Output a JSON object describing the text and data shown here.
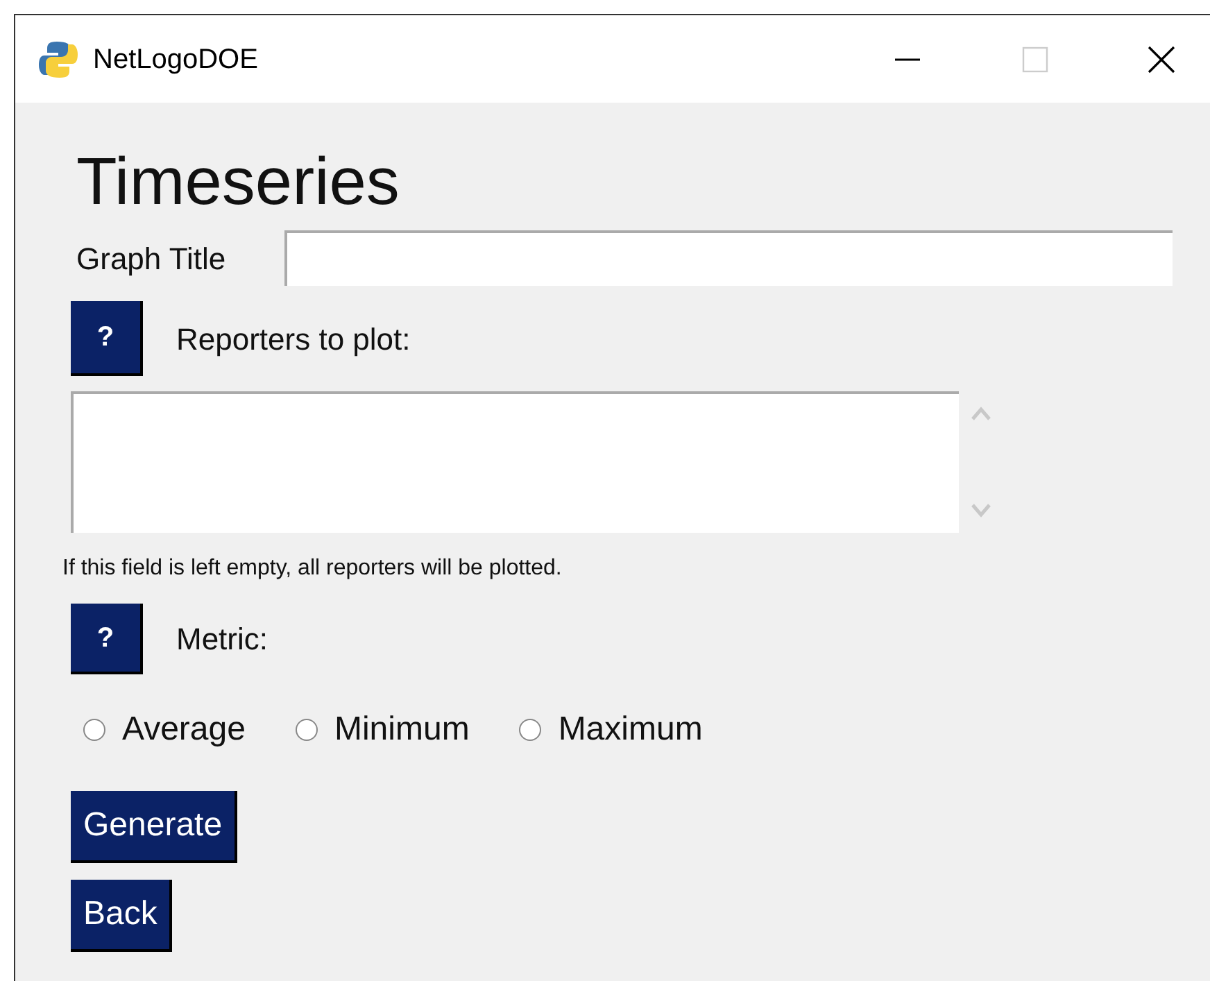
{
  "window": {
    "title": "NetLogoDOE"
  },
  "heading": "Timeseries",
  "graph_title": {
    "label": "Graph Title"
  },
  "reporters": {
    "help": "?",
    "label": "Reporters to plot:",
    "hint": "If this field is left empty, all reporters will be plotted."
  },
  "metric": {
    "help": "?",
    "label": "Metric:",
    "options": [
      {
        "label": "Average",
        "selected": false
      },
      {
        "label": "Minimum",
        "selected": false
      },
      {
        "label": "Maximum",
        "selected": false
      }
    ]
  },
  "buttons": [
    "Generate",
    "Back"
  ]
}
